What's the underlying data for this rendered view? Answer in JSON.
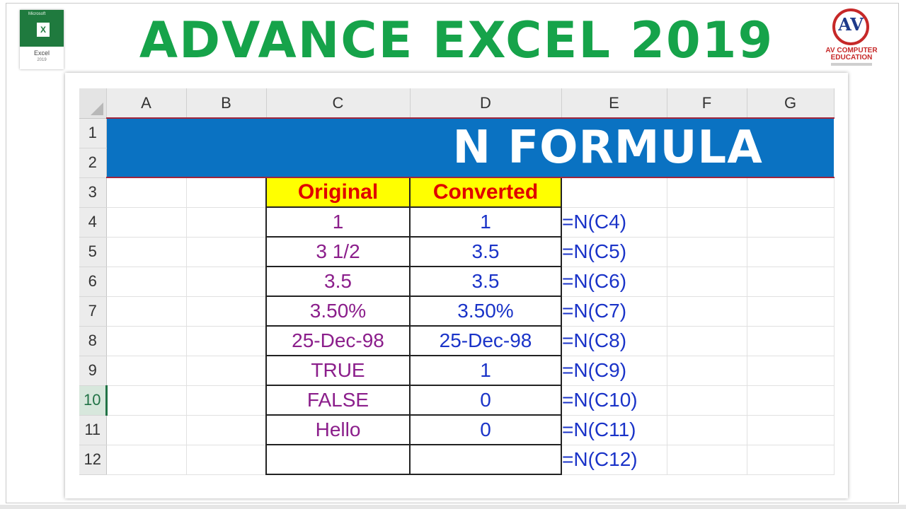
{
  "header": {
    "title": "ADVANCE EXCEL 2019",
    "excel_logo": {
      "brand": "Microsoft",
      "name": "Excel",
      "year": "2019",
      "icon": "excel-icon"
    },
    "av_logo": {
      "letters": "AV",
      "name_line1": "AV COMPUTER",
      "name_line2": "EDUCATION",
      "icon": "av-logo-icon"
    }
  },
  "sheet": {
    "columns": [
      "A",
      "B",
      "C",
      "D",
      "E",
      "F",
      "G"
    ],
    "rows": [
      "1",
      "2",
      "3",
      "4",
      "5",
      "6",
      "7",
      "8",
      "9",
      "10",
      "11",
      "12"
    ],
    "selected_row": "10",
    "banner": "N FORMULA",
    "table_headers": {
      "original": "Original",
      "converted": "Converted"
    },
    "data_rows": [
      {
        "original": "1",
        "converted": "1",
        "formula": "=N(C4)"
      },
      {
        "original": "3 1/2",
        "converted": "3.5",
        "formula": "=N(C5)"
      },
      {
        "original": "3.5",
        "converted": "3.5",
        "formula": "=N(C6)"
      },
      {
        "original": "3.50%",
        "converted": "3.50%",
        "formula": "=N(C7)"
      },
      {
        "original": "25-Dec-98",
        "converted": "25-Dec-98",
        "formula": "=N(C8)"
      },
      {
        "original": "TRUE",
        "converted": "1",
        "formula": "=N(C9)"
      },
      {
        "original": "FALSE",
        "converted": "0",
        "formula": "=N(C10)"
      },
      {
        "original": "Hello",
        "converted": "0",
        "formula": "=N(C11)"
      },
      {
        "original": "",
        "converted": "",
        "formula": "=N(C12)"
      }
    ],
    "colors": {
      "title_green": "#16a34a",
      "banner_blue": "#0a72c2",
      "header_yellow": "#ffff00",
      "header_red": "#e00000",
      "original_purple": "#8b1e8b",
      "converted_blue": "#1a33c8"
    }
  }
}
